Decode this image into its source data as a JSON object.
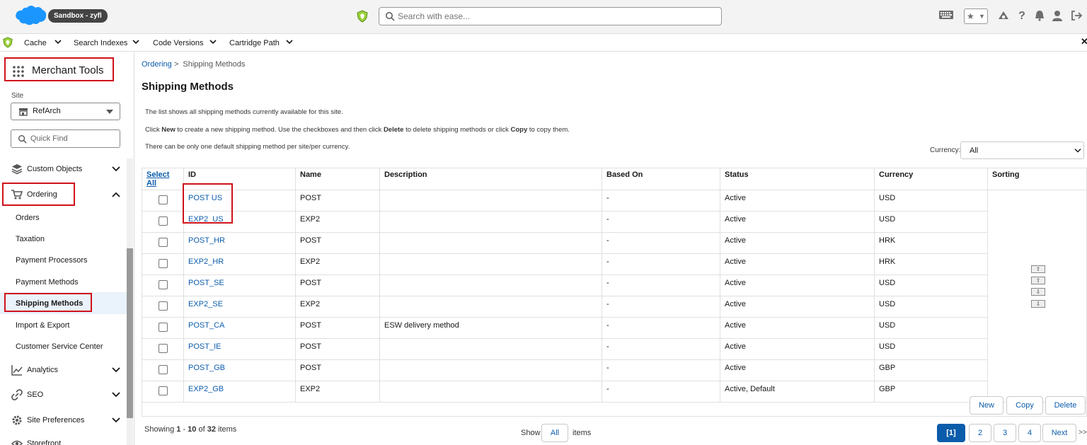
{
  "header": {
    "sandbox_label": "Sandbox - zyfl",
    "search_placeholder": "Search with ease..."
  },
  "nav2": {
    "items": [
      "Cache",
      "Search Indexes",
      "Code Versions",
      "Cartridge Path"
    ]
  },
  "sidebar": {
    "app_name": "Merchant Tools",
    "site_label": "Site",
    "site_value": "RefArch",
    "quickfind_placeholder": "Quick Find",
    "groups": {
      "custom_objects": "Custom Objects",
      "ordering": "Ordering",
      "analytics": "Analytics",
      "seo": "SEO",
      "site_preferences": "Site Preferences",
      "storefront": "Storefront"
    },
    "ordering_items": [
      "Orders",
      "Taxation",
      "Payment Processors",
      "Payment Methods",
      "Shipping Methods",
      "Import & Export",
      "Customer Service Center"
    ]
  },
  "main": {
    "breadcrumb_parent": "Ordering",
    "breadcrumb_sep": ">",
    "breadcrumb_current": "Shipping Methods",
    "title": "Shipping Methods",
    "desc1": "The list shows all shipping methods currently available for this site.",
    "desc2_a": "Click ",
    "desc2_new": "New",
    "desc2_b": " to create a new shipping method. Use the checkboxes and then click ",
    "desc2_delete": "Delete",
    "desc2_c": " to delete shipping methods or click ",
    "desc2_copy": "Copy",
    "desc2_d": " to copy them.",
    "desc3": "There can be only one default shipping method per site/per currency.",
    "currency_label": "Currency:",
    "currency_value": "All"
  },
  "table": {
    "select_all": "Select All",
    "headers": [
      "ID",
      "Name",
      "Description",
      "Based On",
      "Status",
      "Currency",
      "Sorting"
    ],
    "rows": [
      {
        "id": "POST US",
        "name": "POST",
        "description": "",
        "based_on": "-",
        "status": "Active",
        "currency": "USD"
      },
      {
        "id": "EXP2_US",
        "name": "EXP2",
        "description": "",
        "based_on": "-",
        "status": "Active",
        "currency": "USD"
      },
      {
        "id": "POST_HR",
        "name": "POST",
        "description": "",
        "based_on": "-",
        "status": "Active",
        "currency": "HRK"
      },
      {
        "id": "EXP2_HR",
        "name": "EXP2",
        "description": "",
        "based_on": "-",
        "status": "Active",
        "currency": "HRK"
      },
      {
        "id": "POST_SE",
        "name": "POST",
        "description": "",
        "based_on": "-",
        "status": "Active",
        "currency": "USD"
      },
      {
        "id": "EXP2_SE",
        "name": "EXP2",
        "description": "",
        "based_on": "-",
        "status": "Active",
        "currency": "USD"
      },
      {
        "id": "POST_CA",
        "name": "POST",
        "description": "ESW delivery method",
        "based_on": "-",
        "status": "Active",
        "currency": "USD"
      },
      {
        "id": "POST_IE",
        "name": "POST",
        "description": "",
        "based_on": "-",
        "status": "Active",
        "currency": "USD"
      },
      {
        "id": "POST_GB",
        "name": "POST",
        "description": "",
        "based_on": "-",
        "status": "Active",
        "currency": "GBP"
      },
      {
        "id": "EXP2_GB",
        "name": "EXP2",
        "description": "",
        "based_on": "-",
        "status": "Active, Default",
        "currency": "GBP"
      }
    ]
  },
  "actions": {
    "new": "New",
    "copy": "Copy",
    "delete": "Delete"
  },
  "footer": {
    "showing_a": "Showing ",
    "range_start": "1",
    "range_sep": " - ",
    "range_end": "10",
    "of": " of ",
    "total": "32",
    "items_word": " items",
    "show_label": "Show",
    "show_value": "All",
    "items_label": "items",
    "pages": [
      "[1]",
      "2",
      "3",
      "4"
    ],
    "next": "Next",
    "last": ">>"
  },
  "colors": {
    "accent": "#0b5cab",
    "highlight_box": "#d0121b",
    "brand_cloud": "#1b96ff",
    "active_page": "#0b5cab"
  }
}
